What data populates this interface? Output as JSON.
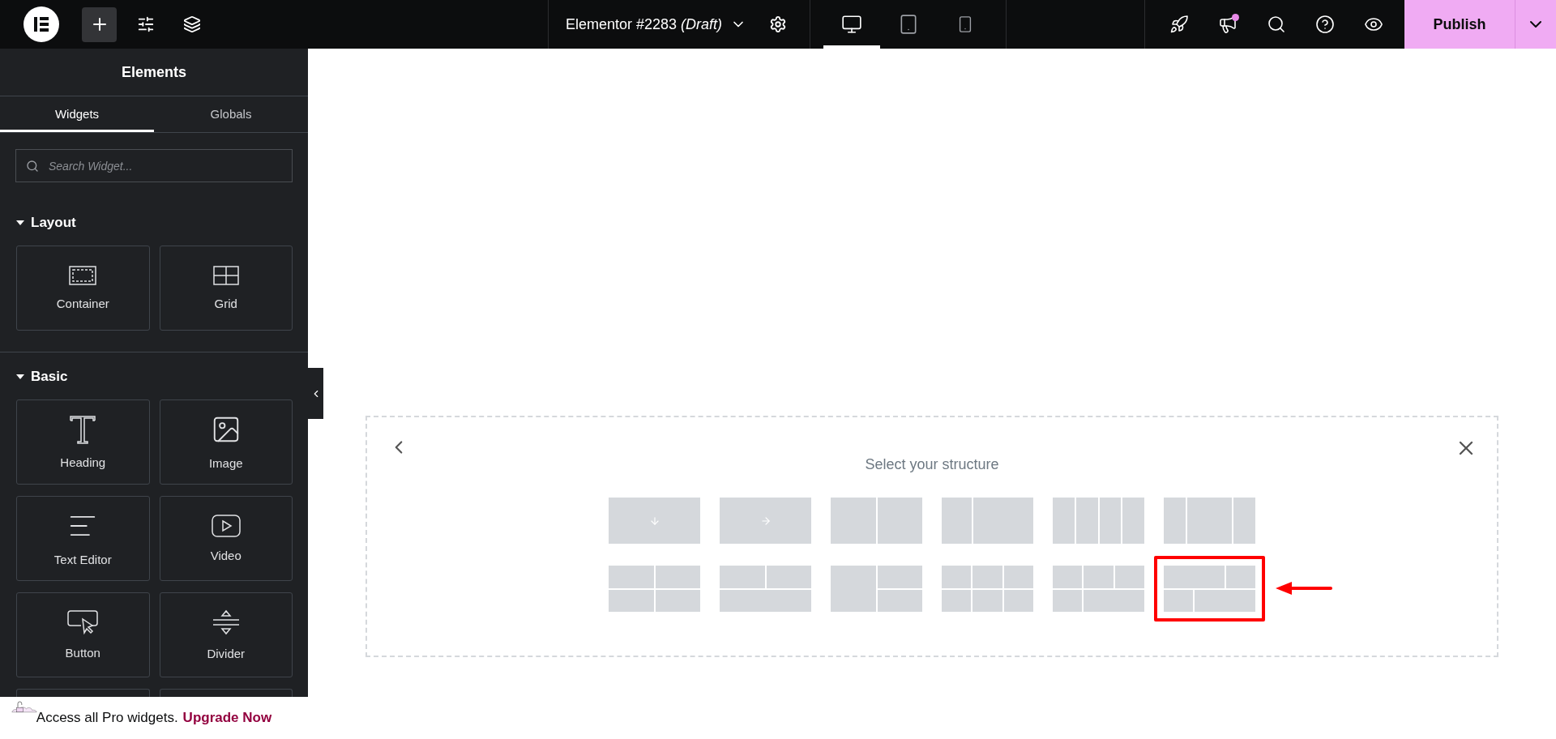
{
  "topbar": {
    "title": "Elementor #2283 *(Draft)*",
    "left_tools": [
      {
        "kind": "add",
        "selected": true
      },
      {
        "kind": "settings-sliders",
        "selected": false
      },
      {
        "kind": "layers",
        "selected": false
      }
    ],
    "devices": [
      {
        "kind": "desktop",
        "selected": true
      },
      {
        "kind": "tablet",
        "selected": false
      },
      {
        "kind": "mobile",
        "selected": false
      }
    ],
    "right_tools": [
      {
        "kind": "rocket",
        "notification": false
      },
      {
        "kind": "megaphone",
        "notification": true
      },
      {
        "kind": "search",
        "notification": false
      },
      {
        "kind": "help",
        "notification": false
      },
      {
        "kind": "preview",
        "notification": false
      }
    ],
    "publish": "Publish"
  },
  "sidebar": {
    "title": "Elements",
    "tabs": [
      {
        "label": "Widgets",
        "selected": true
      },
      {
        "label": "Globals",
        "selected": false
      }
    ],
    "search": {
      "placeholder": "Search Widget..."
    },
    "sections": [
      {
        "title": "Layout",
        "expanded": true,
        "widgets": [
          {
            "kind": "container",
            "label": "Container"
          },
          {
            "kind": "grid",
            "label": "Grid"
          }
        ]
      },
      {
        "title": "Basic",
        "expanded": true,
        "widgets": [
          {
            "kind": "heading",
            "label": "Heading"
          },
          {
            "kind": "image",
            "label": "Image"
          },
          {
            "kind": "text",
            "label": "Text Editor"
          },
          {
            "kind": "video",
            "label": "Video"
          },
          {
            "kind": "button",
            "label": "Button"
          },
          {
            "kind": "divider",
            "label": "Divider"
          },
          {
            "kind": "blank"
          },
          {
            "kind": "blank"
          }
        ]
      }
    ],
    "banner": {
      "text": "Access all Pro widgets.",
      "link": "Upgrade Now"
    }
  },
  "structure": {
    "title": "Select your structure",
    "presets": [
      {
        "kind": "column",
        "selected": false
      },
      {
        "kind": "row",
        "selected": false
      },
      {
        "kind": "halves",
        "selected": false
      },
      {
        "kind": "third-two-thirds",
        "selected": false
      },
      {
        "kind": "quarters",
        "selected": false
      },
      {
        "kind": "quarter-half-quarter",
        "selected": false
      },
      {
        "kind": "grid-2x2",
        "selected": false
      },
      {
        "kind": "two-over-one",
        "selected": false
      },
      {
        "kind": "one-beside-two",
        "selected": false
      },
      {
        "kind": "grid-3x2",
        "selected": false
      },
      {
        "kind": "three-over-one-two",
        "selected": false
      },
      {
        "kind": "two-one-over-one-two",
        "selected": true
      }
    ]
  }
}
